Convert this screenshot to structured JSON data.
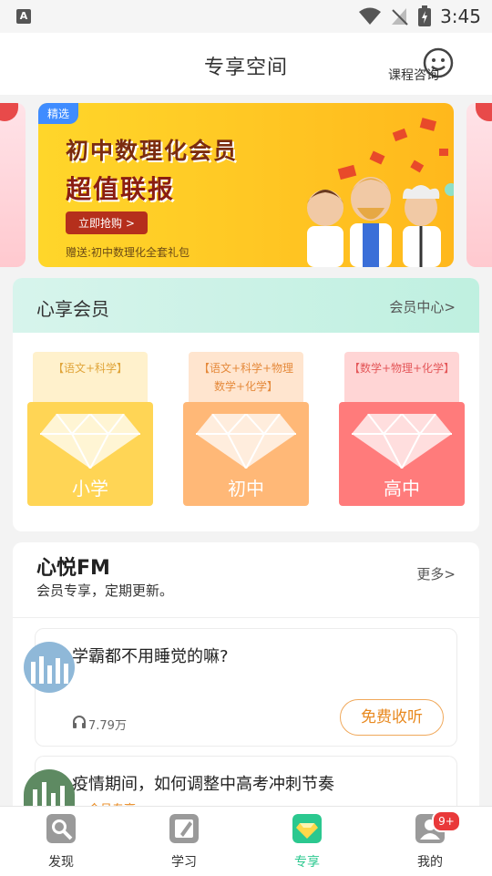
{
  "status_bar": {
    "time": "3:45",
    "left_icon": "A"
  },
  "header": {
    "title": "专享空间",
    "consult_label": "课程咨询"
  },
  "banner": {
    "tag": "精选",
    "line1": "初中数理化会员",
    "line2": "超值联报",
    "button": "立即抢购 >",
    "gift": "赠送:初中数理化全套礼包"
  },
  "member": {
    "title": "心享会员",
    "center_link": "会员中心>",
    "packages": [
      {
        "subjects": "【语文+科学】",
        "name": "小学",
        "color": "#ffd555",
        "sub_bg": "#fff1cc",
        "sub_color": "#e0a53a"
      },
      {
        "subjects": "【语文+科学+物理数学+化学】",
        "name": "初中",
        "color": "#ffb877",
        "sub_bg": "#ffe5cf",
        "sub_color": "#e58a3c"
      },
      {
        "subjects": "【数学+物理+化学】",
        "name": "高中",
        "color": "#ff7b7b",
        "sub_bg": "#ffd5d5",
        "sub_color": "#e4585a"
      }
    ]
  },
  "fm": {
    "title": "心悦FM",
    "subtitle": "会员专享，定期更新。",
    "more": "更多>",
    "items": [
      {
        "title": "学霸都不用睡觉的嘛?",
        "plays": "7.79万",
        "button": "免费收听"
      },
      {
        "title": "疫情期间，如何调整中高考冲刺节奏",
        "plays": "会员专享"
      }
    ]
  },
  "nav": {
    "items": [
      {
        "label": "发现",
        "icon": "discover-icon"
      },
      {
        "label": "学习",
        "icon": "study-icon"
      },
      {
        "label": "专享",
        "icon": "exclusive-icon"
      },
      {
        "label": "我的",
        "icon": "profile-icon",
        "badge": "9+"
      }
    ],
    "active_color": "#2bc88f"
  }
}
